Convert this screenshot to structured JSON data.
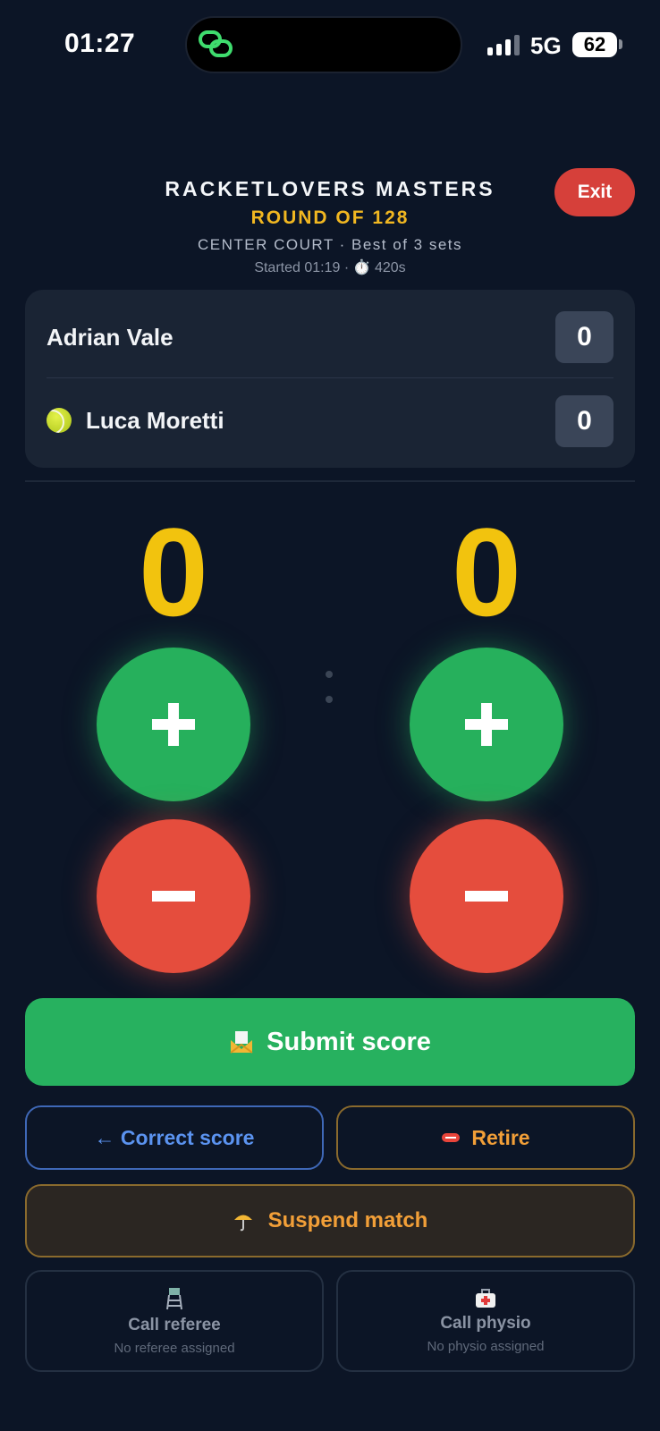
{
  "status_bar": {
    "time": "01:27",
    "network": "5G",
    "battery": "62"
  },
  "header": {
    "title": "RACKETLOVERS MASTERS",
    "round": "ROUND OF 128",
    "court_info": "CENTER COURT · Best of 3 sets",
    "started_info": "Started 01:19 · ⏱️ 420s",
    "exit_label": "Exit"
  },
  "scoreboard": {
    "players": [
      {
        "name": "Adrian Vale",
        "sets": "0",
        "serving": false
      },
      {
        "name": "Luca Moretti",
        "sets": "0",
        "serving": true
      }
    ]
  },
  "game_scores": {
    "player1": "0",
    "player2": "0"
  },
  "actions": {
    "submit_label": "Submit score",
    "correct_label": "← Correct score",
    "retire_label": "Retire",
    "suspend_label": "Suspend match",
    "referee": {
      "title": "Call referee",
      "subtitle": "No referee assigned"
    },
    "physio": {
      "title": "Call physio",
      "subtitle": "No physio assigned"
    }
  },
  "colors": {
    "background": "#0c1526",
    "accent_yellow": "#f2c30e",
    "plus_green": "#26b05c",
    "minus_red": "#e54d3d",
    "exit_red": "#d6403a",
    "outline_blue": "#5b93f0",
    "outline_orange": "#f29f38"
  },
  "icons": {
    "island": "link-chain-icon",
    "serving": "tennis-ball-icon",
    "submit": "envelope-icon",
    "retire": "no-entry-icon",
    "suspend": "umbrella-icon",
    "referee": "umpire-chair-icon",
    "physio": "first-aid-kit-icon"
  }
}
